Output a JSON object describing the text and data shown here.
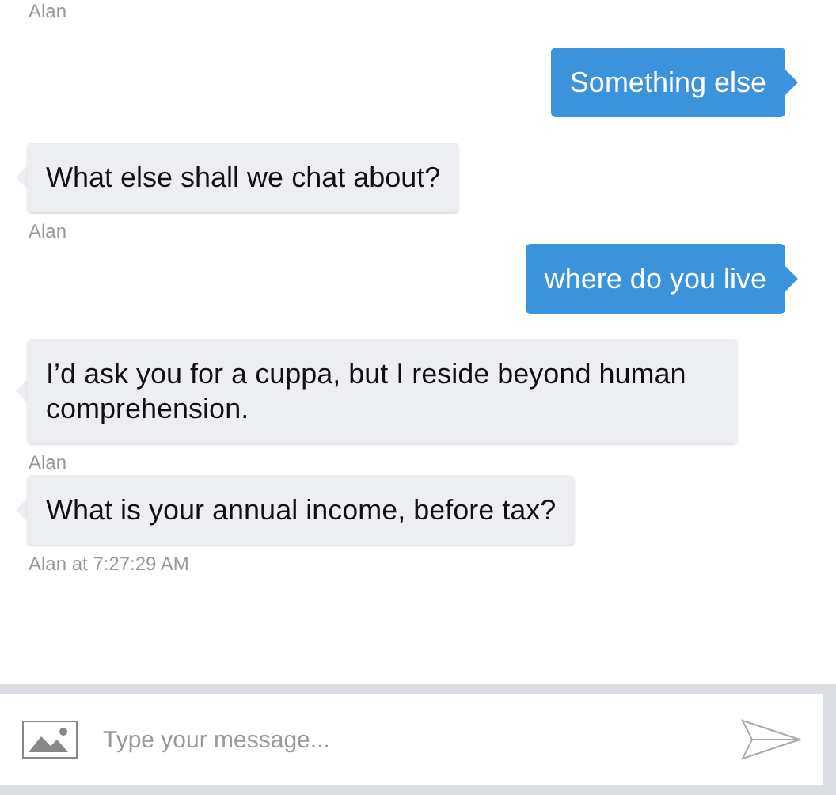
{
  "messages": [
    {
      "kind": "sender",
      "text": "Alan"
    },
    {
      "kind": "user",
      "text": "Something else"
    },
    {
      "kind": "bot",
      "text": "What else shall we chat about?"
    },
    {
      "kind": "sender",
      "text": "Alan"
    },
    {
      "kind": "user",
      "text": "where do you live"
    },
    {
      "kind": "bot",
      "text": "I’d ask you for a cuppa, but I reside beyond human comprehension."
    },
    {
      "kind": "sender",
      "text": "Alan"
    },
    {
      "kind": "bot",
      "text": "What is your annual income, before tax?"
    },
    {
      "kind": "sender",
      "text": "Alan at 7:27:29 AM"
    }
  ],
  "composer": {
    "placeholder": "Type your message..."
  }
}
